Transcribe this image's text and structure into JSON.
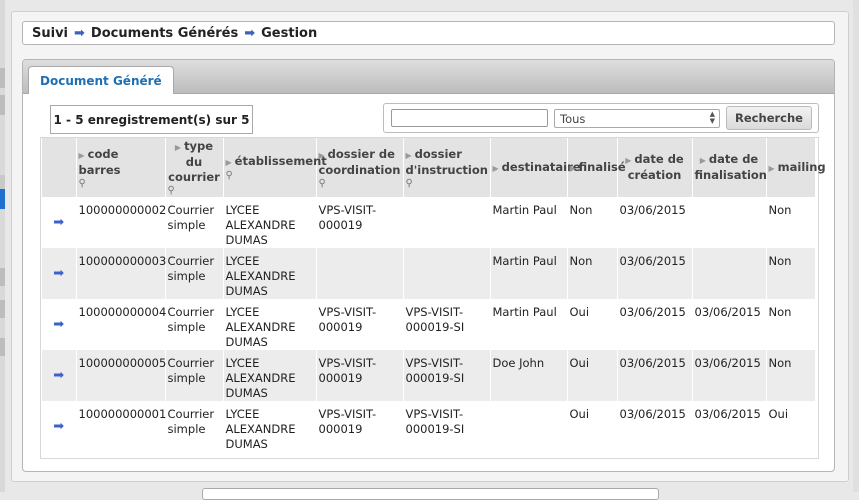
{
  "breadcrumb": {
    "items": [
      "Suivi",
      "Documents Générés",
      "Gestion"
    ],
    "separator_icon": "arrow-right-icon"
  },
  "tabs": [
    {
      "label": "Document Généré",
      "active": true
    }
  ],
  "record_count": "1 - 5 enregistrement(s) sur 5",
  "search": {
    "input_value": "",
    "select_value": "Tous",
    "button_label": "Recherche"
  },
  "table": {
    "columns": [
      {
        "label": "",
        "filter": false
      },
      {
        "label": "code barres",
        "filter": true
      },
      {
        "label": "type du courrier",
        "filter": true
      },
      {
        "label": "établissement",
        "filter": true
      },
      {
        "label": "dossier de coordination",
        "filter": true
      },
      {
        "label": "dossier d'instruction",
        "filter": true
      },
      {
        "label": "destinataire",
        "filter": false
      },
      {
        "label": "finalisé",
        "filter": false
      },
      {
        "label": "date de création",
        "filter": false
      },
      {
        "label": "date de finalisation",
        "filter": false
      },
      {
        "label": "mailing",
        "filter": false
      }
    ],
    "rows": [
      {
        "code": "100000000002",
        "type": "Courrier simple",
        "etablissement": "LYCEE ALEXANDRE DUMAS",
        "coordination": "VPS-VISIT-000019",
        "instruction": "",
        "destinataire": "Martin Paul",
        "finalise": "Non",
        "date_creation": "03/06/2015",
        "date_finalisation": "",
        "mailing": "Non"
      },
      {
        "code": "100000000003",
        "type": "Courrier simple",
        "etablissement": "LYCEE ALEXANDRE DUMAS",
        "coordination": "",
        "instruction": "",
        "destinataire": "Martin Paul",
        "finalise": "Non",
        "date_creation": "03/06/2015",
        "date_finalisation": "",
        "mailing": "Non"
      },
      {
        "code": "100000000004",
        "type": "Courrier simple",
        "etablissement": "LYCEE ALEXANDRE DUMAS",
        "coordination": "VPS-VISIT-000019",
        "instruction": "VPS-VISIT-000019-SI",
        "destinataire": "Martin Paul",
        "finalise": "Oui",
        "date_creation": "03/06/2015",
        "date_finalisation": "03/06/2015",
        "mailing": "Non"
      },
      {
        "code": "100000000005",
        "type": "Courrier simple",
        "etablissement": "LYCEE ALEXANDRE DUMAS",
        "coordination": "VPS-VISIT-000019",
        "instruction": "VPS-VISIT-000019-SI",
        "destinataire": "Doe John",
        "finalise": "Oui",
        "date_creation": "03/06/2015",
        "date_finalisation": "03/06/2015",
        "mailing": "Non"
      },
      {
        "code": "100000000001",
        "type": "Courrier simple",
        "etablissement": "LYCEE ALEXANDRE DUMAS",
        "coordination": "VPS-VISIT-000019",
        "instruction": "VPS-VISIT-000019-SI",
        "destinataire": "",
        "finalise": "Oui",
        "date_creation": "03/06/2015",
        "date_finalisation": "03/06/2015",
        "mailing": "Oui"
      }
    ]
  },
  "colors": {
    "accent": "#1f6fb4",
    "arrow": "#3b63c7",
    "header_bg": "#e3e3e3",
    "alt_row": "#ececec"
  }
}
